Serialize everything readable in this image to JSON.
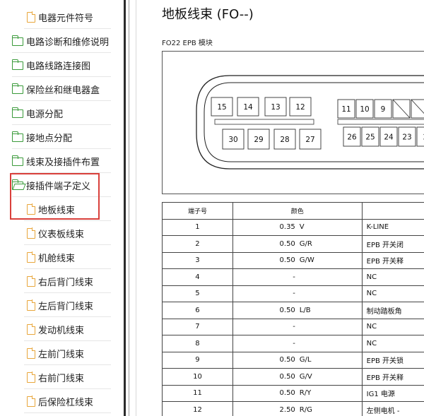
{
  "sidebar": {
    "items": [
      {
        "label": "电器元件符号",
        "level": 2,
        "icon": "document-icon"
      },
      {
        "label": "电路诊断和维修说明",
        "level": 1,
        "icon": "folder-icon"
      },
      {
        "label": "电路线路连接图",
        "level": 1,
        "icon": "folder-icon"
      },
      {
        "label": "保险丝和继电器盒",
        "level": 1,
        "icon": "folder-icon"
      },
      {
        "label": "电源分配",
        "level": 1,
        "icon": "folder-icon"
      },
      {
        "label": "接地点分配",
        "level": 1,
        "icon": "folder-icon"
      },
      {
        "label": "线束及接插件布置",
        "level": 1,
        "icon": "folder-icon"
      },
      {
        "label": "接插件端子定义",
        "level": 1,
        "icon": "folder-open-icon"
      },
      {
        "label": "地板线束",
        "level": 2,
        "icon": "document-icon"
      },
      {
        "label": "仪表板线束",
        "level": 2,
        "icon": "document-icon"
      },
      {
        "label": "机舱线束",
        "level": 2,
        "icon": "document-icon"
      },
      {
        "label": "右后背门线束",
        "level": 2,
        "icon": "document-icon"
      },
      {
        "label": "左后背门线束",
        "level": 2,
        "icon": "document-icon"
      },
      {
        "label": "发动机线束",
        "level": 2,
        "icon": "document-icon"
      },
      {
        "label": "左前门线束",
        "level": 2,
        "icon": "document-icon"
      },
      {
        "label": "右前门线束",
        "level": 2,
        "icon": "document-icon"
      },
      {
        "label": "后保险杠线束",
        "level": 2,
        "icon": "document-icon"
      }
    ],
    "highlight_color": "#d9403b",
    "folder_color": "#3a9a3a",
    "document_color": "#e8a63b"
  },
  "content": {
    "title": "地板线束 (FO--)",
    "module_label": "FO22 EPB 模块",
    "connector": {
      "top_left_pins": [
        "15",
        "14",
        "13",
        "12"
      ],
      "bottom_left_pins": [
        "30",
        "29",
        "28",
        "27"
      ],
      "top_right_pins": [
        "11",
        "10",
        "9"
      ],
      "bottom_right_pins": [
        "26",
        "25",
        "24",
        "23",
        "2"
      ]
    },
    "table": {
      "headers": [
        "端子号",
        "颜色",
        ""
      ],
      "rows": [
        {
          "pin": "1",
          "size": "0.35",
          "color": "V",
          "desc": "K-LINE"
        },
        {
          "pin": "2",
          "size": "0.50",
          "color": "G/R",
          "desc": "EPB 开关闭"
        },
        {
          "pin": "3",
          "size": "0.50",
          "color": "G/W",
          "desc": "EPB 开关释"
        },
        {
          "pin": "4",
          "size": "-",
          "color": "",
          "desc": "NC"
        },
        {
          "pin": "5",
          "size": "-",
          "color": "",
          "desc": "NC"
        },
        {
          "pin": "6",
          "size": "0.50",
          "color": "L/B",
          "desc": "制动踏板角"
        },
        {
          "pin": "7",
          "size": "-",
          "color": "",
          "desc": "NC"
        },
        {
          "pin": "8",
          "size": "-",
          "color": "",
          "desc": "NC"
        },
        {
          "pin": "9",
          "size": "0.50",
          "color": "G/L",
          "desc": "EPB 开关锁"
        },
        {
          "pin": "10",
          "size": "0.50",
          "color": "G/V",
          "desc": "EPB 开关释"
        },
        {
          "pin": "11",
          "size": "0.50",
          "color": "R/Y",
          "desc": "IG1 电源"
        },
        {
          "pin": "12",
          "size": "2.50",
          "color": "R/G",
          "desc": "左侧电机 -"
        }
      ]
    }
  }
}
